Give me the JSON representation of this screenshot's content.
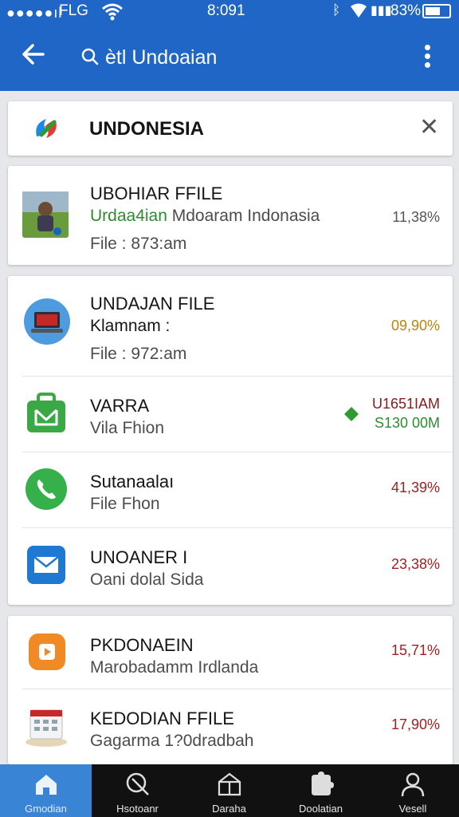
{
  "status_bar": {
    "signal": "●●●●●ıl",
    "carrier": "FLG",
    "time": "8:091",
    "battery_percent": "83%"
  },
  "app_bar": {
    "back_icon": "back-arrow-icon",
    "search_icon": "search-icon",
    "query": "ѐtl Undoaian",
    "more_icon": "more-vert-icon",
    "color": "#1f66c7"
  },
  "search_box": {
    "logo": "app-logo-icon",
    "text": "UNDONESIA",
    "close_label": "✕"
  },
  "results": [
    {
      "card": 1,
      "title": "UBOHIAR FFILE",
      "subtitle": "Urdaa4ian",
      "subtitle_rest": " Mdoaram Indonasia",
      "line3": "File :  873:am",
      "value": "11,38%",
      "value_color": "#555555",
      "icon": "video-thumbnail-icon"
    },
    {
      "card": 2,
      "title": "UNDAJAN FILE",
      "subtitle": "Klamnam  :",
      "line3": "File :  972:am",
      "value": "09,90%",
      "value_color": "#b8860b",
      "icon": "laptop-icon"
    },
    {
      "card": 2,
      "title": "VARRA",
      "subtitle": "Vila Fhion",
      "value": "U1651IAM",
      "value2": "S130 00M",
      "value_color": "#8b1a1a",
      "value2_color": "#2e8b30",
      "diamond_color": "#2e9b2e",
      "icon": "shopping-bag-icon"
    },
    {
      "card": 2,
      "title": "Sutanaalaı",
      "subtitle": "File Fhon",
      "value": "41,39%",
      "value_color": "#a32020",
      "icon": "phone-icon"
    },
    {
      "card": 2,
      "title": "UNOANER I",
      "subtitle": "Oani dolal Sida",
      "value": "23,38%",
      "value_color": "#a32020",
      "icon": "mail-icon"
    },
    {
      "card": 3,
      "title": "PKDONAEIN",
      "subtitle": "Marobadamm Irdlanda",
      "value": "15,71%",
      "value_color": "#a32020",
      "icon": "play-icon"
    },
    {
      "card": 3,
      "title": "KEDODIAN FFILE",
      "subtitle": "Gagarma 1?0dradbah",
      "value": "17,90%",
      "value_color": "#a32020",
      "icon": "calendar-icon"
    }
  ],
  "bottom_nav": [
    {
      "label": "Gmodian",
      "icon": "home-icon",
      "active": true
    },
    {
      "label": "Hsotoanr",
      "icon": "search-icon",
      "active": false
    },
    {
      "label": "Daraha",
      "icon": "store-icon",
      "active": false
    },
    {
      "label": "Doolatian",
      "icon": "puzzle-icon",
      "active": false
    },
    {
      "label": "Vesell",
      "icon": "profile-icon",
      "active": false
    }
  ]
}
